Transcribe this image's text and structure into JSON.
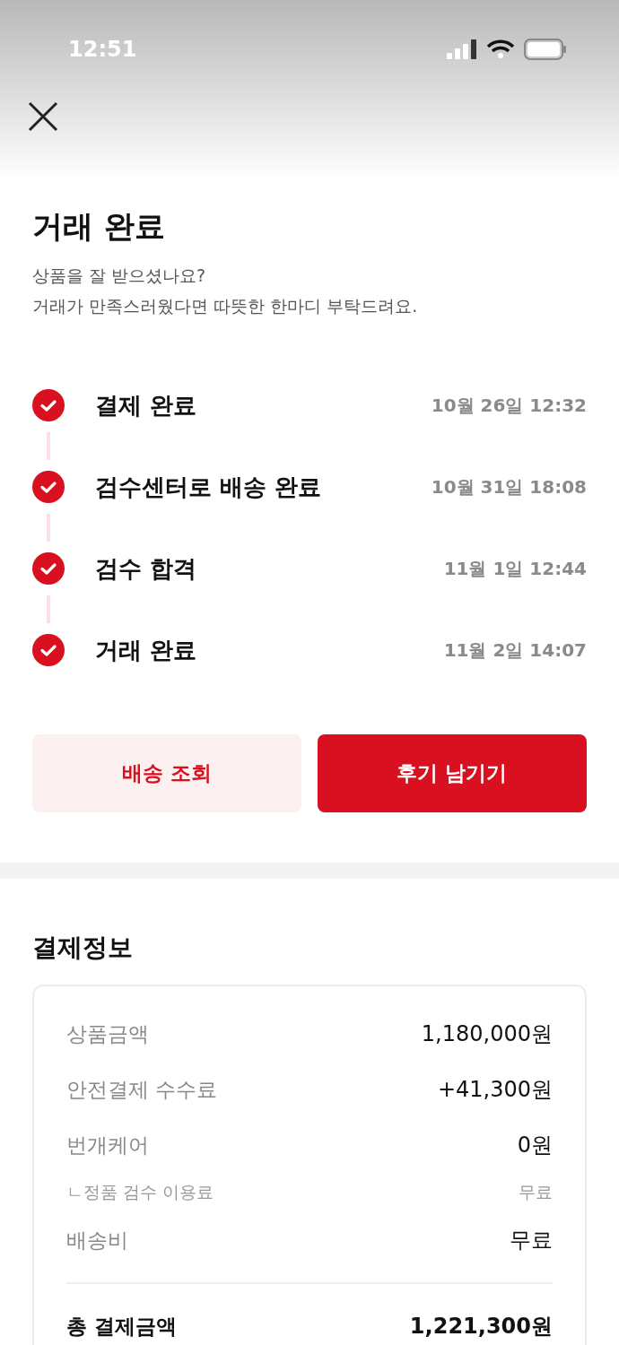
{
  "status_bar": {
    "time": "12:51"
  },
  "title": "거래 완료",
  "subtitle_lines": [
    "상품을 잘 받으셨나요?",
    "거래가 만족스러웠다면 따뜻한 한마디 부탁드려요."
  ],
  "steps": [
    {
      "label": "결제 완료",
      "time": "10월 26일 12:32",
      "done": true
    },
    {
      "label": "검수센터로 배송 완료",
      "time": "10월 31일 18:08",
      "done": true
    },
    {
      "label": "검수 합격",
      "time": "11월 1일 12:44",
      "done": true
    },
    {
      "label": "거래 완료",
      "time": "11월 2일 14:07",
      "done": true
    }
  ],
  "buttons": [
    {
      "label": "배송 조회",
      "kind": "secondary"
    },
    {
      "label": "후기 남기기",
      "kind": "primary"
    }
  ],
  "payment": {
    "title": "결제정보",
    "rows": [
      {
        "label": "상품금액",
        "value": "1,180,000원",
        "kind": "main"
      },
      {
        "label": "안전결제 수수료",
        "value": "+41,300원",
        "kind": "main"
      },
      {
        "label": "번개케어",
        "value": "0원",
        "kind": "main"
      },
      {
        "label": "ㄴ정품 검수 이용료",
        "value": "무료",
        "kind": "sub"
      },
      {
        "label": "배송비",
        "value": "무료",
        "kind": "main"
      },
      {
        "label": "총 결제금액",
        "value": "1,221,300원",
        "kind": "total"
      }
    ]
  }
}
